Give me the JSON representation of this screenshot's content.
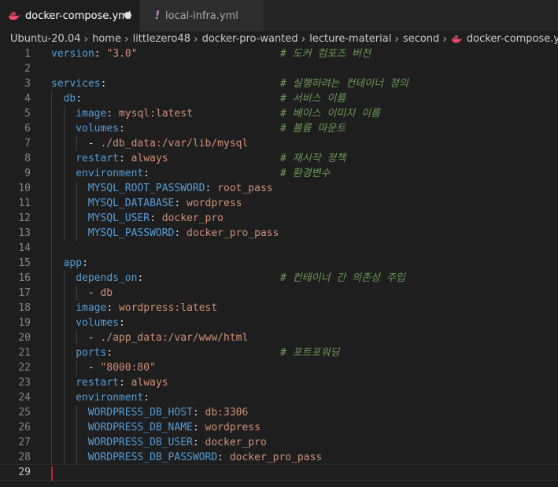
{
  "tabs": [
    {
      "label": "docker-compose.yml",
      "icon": "docker-whale-icon",
      "active": true,
      "modified": true
    },
    {
      "label": "local-infra.yml",
      "icon": "exclamation-icon",
      "active": false,
      "modified": false
    }
  ],
  "breadcrumb": [
    "Ubuntu-20.04",
    "home",
    "littlezero48",
    "docker-pro-wanted",
    "lecture-material",
    "second",
    "docker-compose.yml"
  ],
  "colors": {
    "key": "#569cd6",
    "string": "#ce9178",
    "comment": "#6a9955",
    "docker": "#f14c6b",
    "cursor": "#c0202a"
  },
  "editor": {
    "cursor_line": 29,
    "lines": [
      {
        "n": "1",
        "k": "version",
        "s": "\"3.0\"",
        "c": "# 도커 컴포즈 버전"
      },
      {
        "n": "2"
      },
      {
        "n": "3",
        "k": "services",
        "c": "# 실행하려는 컨테이너 정의"
      },
      {
        "n": "4",
        "k": "db",
        "c": "# 서비스 이름"
      },
      {
        "n": "5",
        "k": "image",
        "s": "mysql:latest",
        "c": "# 베이스 이미지 이름"
      },
      {
        "n": "6",
        "k": "volumes",
        "c": "# 볼륨 마운트"
      },
      {
        "n": "7",
        "s": "./db_data:/var/lib/mysql"
      },
      {
        "n": "8",
        "k": "restart",
        "s": "always",
        "c": "# 재시작 정책"
      },
      {
        "n": "9",
        "k": "environment",
        "c": "# 환경변수"
      },
      {
        "n": "10",
        "k": "MYSQL_ROOT_PASSWORD",
        "s": "root_pass"
      },
      {
        "n": "11",
        "k": "MYSQL_DATABASE",
        "s": "wordpress"
      },
      {
        "n": "12",
        "k": "MYSQL_USER",
        "s": "docker_pro"
      },
      {
        "n": "13",
        "k": "MYSQL_PASSWORD",
        "s": "docker_pro_pass"
      },
      {
        "n": "14"
      },
      {
        "n": "15",
        "k": "app"
      },
      {
        "n": "16",
        "k": "depends_on",
        "c": "# 컨테이너 간 의존성 주입"
      },
      {
        "n": "17",
        "s": "db"
      },
      {
        "n": "18",
        "k": "image",
        "s": "wordpress:latest"
      },
      {
        "n": "19",
        "k": "volumes"
      },
      {
        "n": "20",
        "s": "./app_data:/var/www/html"
      },
      {
        "n": "21",
        "k": "ports",
        "c": "# 포트포워딩"
      },
      {
        "n": "22",
        "s": "\"8000:80\""
      },
      {
        "n": "23",
        "k": "restart",
        "s": "always"
      },
      {
        "n": "24",
        "k": "environment"
      },
      {
        "n": "25",
        "k": "WORDPRESS_DB_HOST",
        "s": "db:3306"
      },
      {
        "n": "26",
        "k": "WORDPRESS_DB_NAME",
        "s": "wordpress"
      },
      {
        "n": "27",
        "k": "WORDPRESS_DB_USER",
        "s": "docker_pro"
      },
      {
        "n": "28",
        "k": "WORDPRESS_DB_PASSWORD",
        "s": "docker_pro_pass"
      },
      {
        "n": "29"
      }
    ]
  }
}
